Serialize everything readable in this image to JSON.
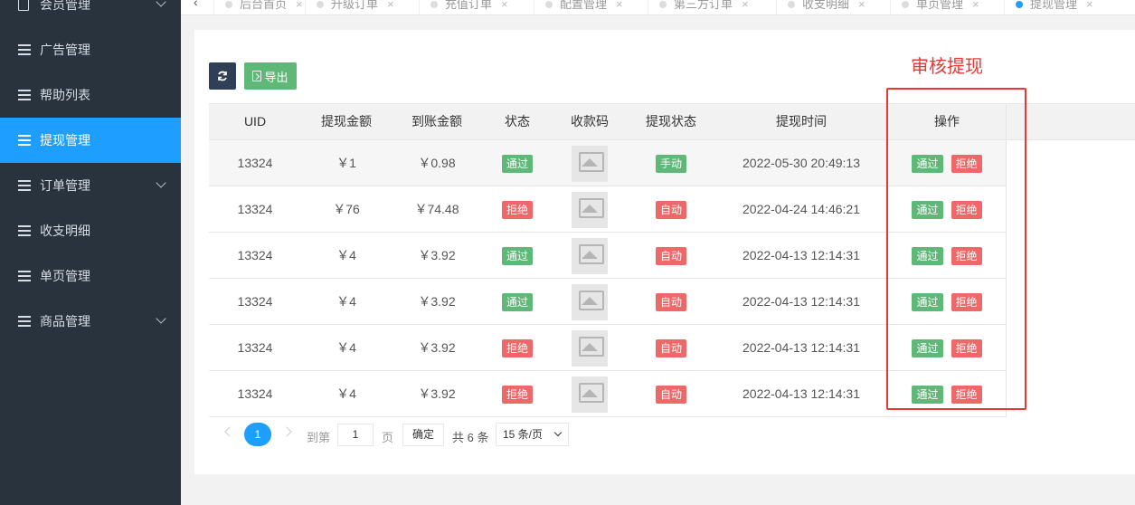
{
  "sidebar": {
    "items": [
      {
        "label": "会员管理",
        "icon": "checklist-icon",
        "has_arrow": true
      },
      {
        "label": "广告管理",
        "icon": "list-icon"
      },
      {
        "label": "帮助列表",
        "icon": "list-icon"
      },
      {
        "label": "提现管理",
        "icon": "list-icon",
        "active": true
      },
      {
        "label": "订单管理",
        "icon": "list-icon",
        "has_arrow": true
      },
      {
        "label": "收支明细",
        "icon": "list-icon"
      },
      {
        "label": "单页管理",
        "icon": "list-icon"
      },
      {
        "label": "商品管理",
        "icon": "list-icon",
        "has_arrow": true
      }
    ]
  },
  "tabs": [
    {
      "label": "后台首页"
    },
    {
      "label": "升级订单"
    },
    {
      "label": "充值订单"
    },
    {
      "label": "配置管理"
    },
    {
      "label": "第三方订单"
    },
    {
      "label": "收支明细"
    },
    {
      "label": "单页管理"
    },
    {
      "label": "提现管理",
      "active": true
    }
  ],
  "toolbar": {
    "export_label": "导出"
  },
  "annotation": {
    "title": "审核提现",
    "color": "#e53935"
  },
  "table": {
    "headers": [
      "UID",
      "提现金额",
      "到账金额",
      "状态",
      "收款码",
      "提现状态",
      "提现时间",
      "操作"
    ],
    "rows": [
      {
        "uid": "13324",
        "amount": "￥1",
        "received": "￥0.98",
        "status": "通过",
        "method": "手动",
        "time": "2022-05-30 20:49:13"
      },
      {
        "uid": "13324",
        "amount": "￥76",
        "received": "￥74.48",
        "status": "拒绝",
        "method": "自动",
        "time": "2022-04-24 14:46:21"
      },
      {
        "uid": "13324",
        "amount": "￥4",
        "received": "￥3.92",
        "status": "通过",
        "method": "自动",
        "time": "2022-04-13 12:14:31"
      },
      {
        "uid": "13324",
        "amount": "￥4",
        "received": "￥3.92",
        "status": "通过",
        "method": "自动",
        "time": "2022-04-13 12:14:31"
      },
      {
        "uid": "13324",
        "amount": "￥4",
        "received": "￥3.92",
        "status": "拒绝",
        "method": "自动",
        "time": "2022-04-13 12:14:31"
      },
      {
        "uid": "13324",
        "amount": "￥4",
        "received": "￥3.92",
        "status": "拒绝",
        "method": "自动",
        "time": "2022-04-13 12:14:31"
      }
    ],
    "action_approve": "通过",
    "action_reject": "拒绝"
  },
  "pagination": {
    "current": "1",
    "goto_label": "到第",
    "goto_value": "1",
    "page_label": "页",
    "confirm_label": "确定",
    "total_label": "共 6 条",
    "per_page": "15 条/页"
  },
  "colors": {
    "accent": "#1e9fff",
    "green": "#5fb878",
    "red": "#ed6868",
    "sidebar": "#28333e"
  }
}
